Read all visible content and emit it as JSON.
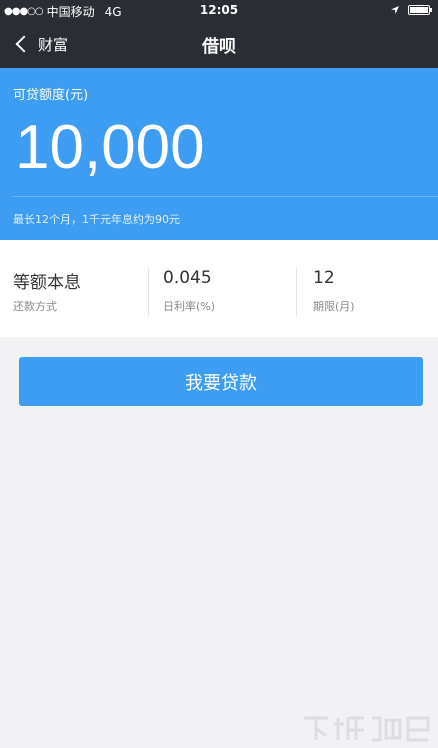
{
  "status_bar": {
    "carrier": "中国移动",
    "network": "4G",
    "time": "12:05"
  },
  "nav": {
    "back_label": "财富",
    "title": "借呗"
  },
  "banner": {
    "label": "可贷额度(元)",
    "amount": "10,000",
    "note": "最长12个月，1千元年息约为90元"
  },
  "info": [
    {
      "value": "等额本息",
      "label": "还款方式"
    },
    {
      "value": "0.045",
      "label": "日利率(%)"
    },
    {
      "value": "12",
      "label": "期限(月)"
    }
  ],
  "action": {
    "button_label": "我要贷款"
  },
  "colors": {
    "accent_blue": "#3d9df2",
    "nav_dark": "#2a2d33",
    "background": "#f2f2f4"
  }
}
